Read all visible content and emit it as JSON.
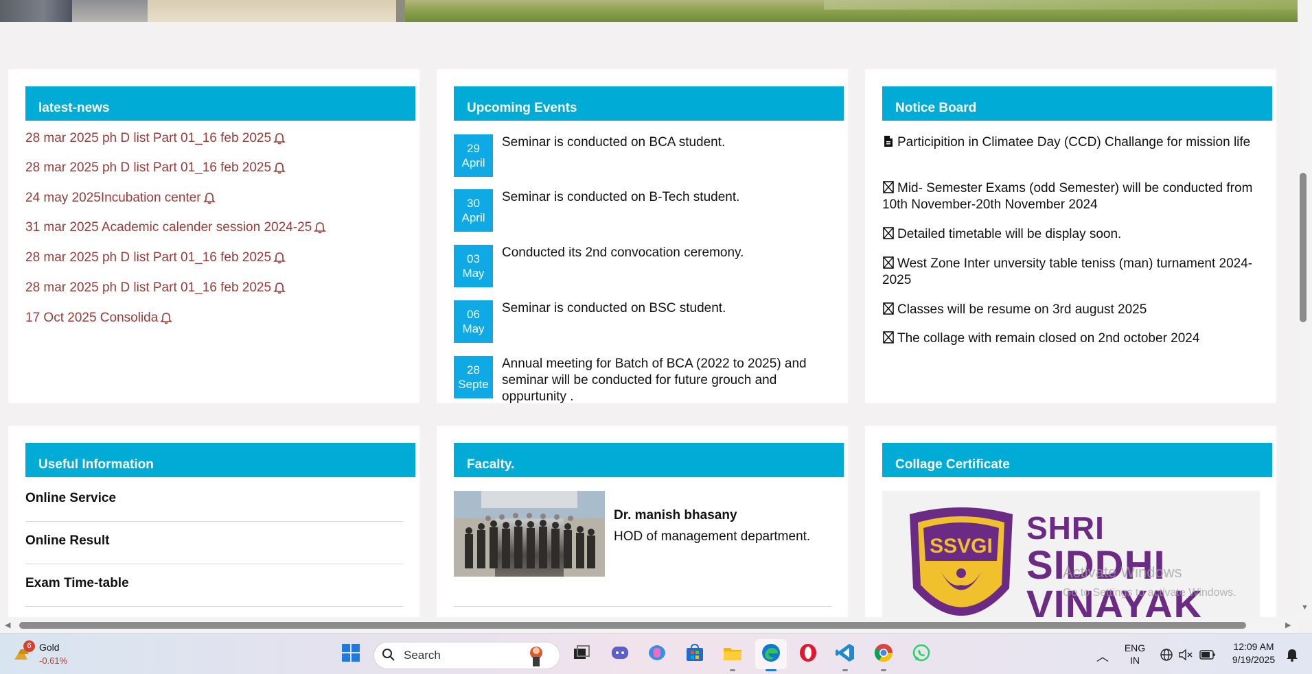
{
  "latest_news": {
    "title": "latest-news",
    "items": [
      "28 mar 2025 ph D list Part 01_16 feb 2025",
      "28 mar 2025 ph D list Part 01_16 feb 2025",
      "24 may 2025Incubation center",
      "31 mar 2025 Academic calender session 2024-25",
      "28 mar 2025 ph D list Part 01_16 feb 2025",
      "28 mar 2025 ph D list Part 01_16 feb 2025",
      "17 Oct 2025 Consolida"
    ]
  },
  "upcoming_events": {
    "title": "Upcoming Events",
    "events": [
      {
        "day": "29",
        "month": "April",
        "text": "Seminar is conducted on BCA student."
      },
      {
        "day": "30",
        "month": "April",
        "text": "Seminar is conducted on B-Tech student."
      },
      {
        "day": "03",
        "month": "May",
        "text": "Conducted its 2nd convocation ceremony."
      },
      {
        "day": "06",
        "month": "May",
        "text": "Seminar is conducted on BSC student."
      },
      {
        "day": "28",
        "month": "Septe",
        "text": "Annual meeting for Batch of BCA (2022 to 2025) and seminar will be conducted for future grouch and oppurtunity ."
      }
    ]
  },
  "notice_board": {
    "title": "Notice Board",
    "items": [
      "Participition in Climatee Day (CCD) Challange for mission life",
      "Mid- Semester Exams (odd Semester) will be conducted from 10th November-20th November 2024",
      "Detailed timetable will be display soon.",
      "West Zone Inter unversity table teniss (man) turnament 2024-2025",
      "Classes will be resume on 3rd august 2025",
      "The collage with remain closed on 2nd october 2024"
    ]
  },
  "useful_information": {
    "title": "Useful Information",
    "links": [
      "Online Service",
      "Online Result",
      "Exam Time-table"
    ]
  },
  "faculty": {
    "title": "Facalty.",
    "name": "Dr. manish bhasany",
    "role": "HOD of management department."
  },
  "certificate": {
    "title": "Collage Certificate",
    "logo_text": "SSVGI",
    "lines": [
      "SHRI",
      "SIDDHI",
      "VINAYAK"
    ]
  },
  "watermark": {
    "line1": "Activate Windows",
    "line2": "Go to Settings to activate Windows."
  },
  "taskbar": {
    "stock_name": "Gold",
    "stock_change": "-0.61%",
    "stock_badge": "6",
    "search_label": "Search",
    "lang_1": "ENG",
    "lang_2": "IN",
    "time": "12:09 AM",
    "date": "9/19/2025"
  },
  "colors": {
    "header_bg": "#00abd6",
    "news_text": "#9a3a36",
    "date_box": "#0fa9e6"
  }
}
